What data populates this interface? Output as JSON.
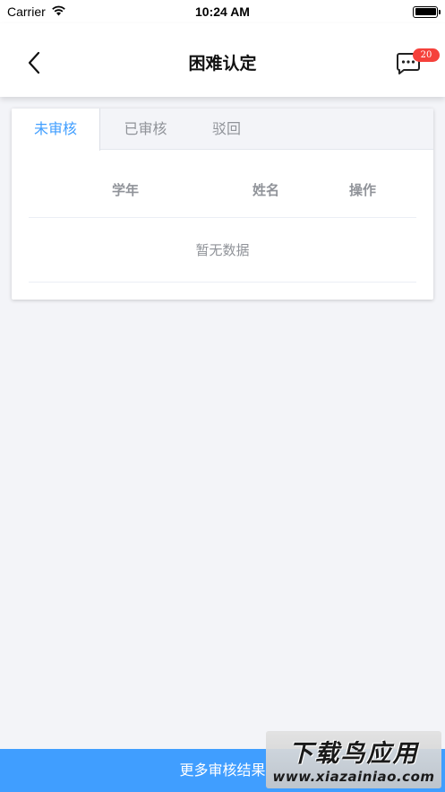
{
  "status_bar": {
    "carrier": "Carrier",
    "time": "10:24 AM"
  },
  "nav": {
    "title": "困难认定",
    "message_badge": "20",
    "back_icon": "chevron-left-icon",
    "message_icon": "chat-bubble-icon"
  },
  "tabs": [
    {
      "label": "未审核",
      "active": true
    },
    {
      "label": "已审核",
      "active": false
    },
    {
      "label": "驳回",
      "active": false
    }
  ],
  "table": {
    "columns": [
      "学年",
      "姓名",
      "操作"
    ],
    "empty_text": "暂无数据"
  },
  "bottom_button": {
    "label": "更多审核结果"
  },
  "watermark": {
    "title": "下载鸟应用",
    "url": "www.xiazainiao.com"
  },
  "colors": {
    "accent": "#409eff",
    "badge": "#f5413b",
    "background": "#f3f4f8"
  }
}
